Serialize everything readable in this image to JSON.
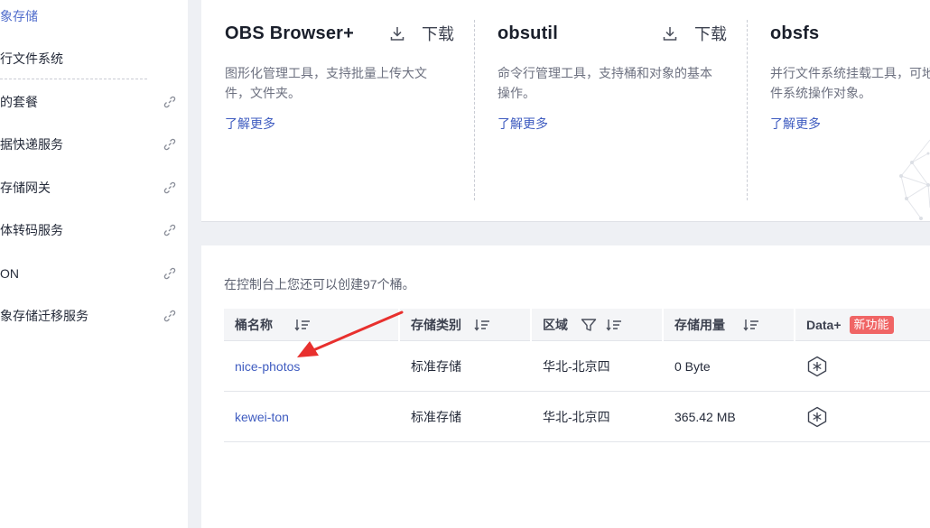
{
  "sidebar": {
    "items": [
      {
        "label": "象存储",
        "active": true,
        "external": false
      },
      {
        "label": "行文件系统",
        "active": false,
        "external": false
      },
      {
        "label": "的套餐",
        "active": false,
        "external": true
      },
      {
        "label": "据快递服务",
        "active": false,
        "external": true
      },
      {
        "label": "存储网关",
        "active": false,
        "external": true
      },
      {
        "label": "体转码服务",
        "active": false,
        "external": true
      },
      {
        "label": "ON",
        "active": false,
        "external": true
      },
      {
        "label": "象存储迁移服务",
        "active": false,
        "external": true
      }
    ]
  },
  "tools": [
    {
      "name": "OBS Browser+",
      "download_label": "下载",
      "description": "图形化管理工具，支持批量上传大文件，文件夹。",
      "more_label": "了解更多"
    },
    {
      "name": "obsutil",
      "download_label": "下载",
      "description": "命令行管理工具，支持桶和对象的基本操作。",
      "more_label": "了解更多"
    },
    {
      "name": "obsfs",
      "download_label": "",
      "description": "并行文件系统挂载工具，可地文件系统操作对象。",
      "more_label": "了解更多"
    }
  ],
  "buckets": {
    "hint": "在控制台上您还可以创建97个桶。",
    "columns": [
      {
        "label": "桶名称",
        "sortable": true,
        "filterable": false
      },
      {
        "label": "存储类别",
        "sortable": true,
        "filterable": false
      },
      {
        "label": "区域",
        "sortable": true,
        "filterable": true
      },
      {
        "label": "存储用量",
        "sortable": true,
        "filterable": false
      },
      {
        "label": "Data+",
        "sortable": false,
        "filterable": false,
        "badge": "新功能"
      }
    ],
    "rows": [
      {
        "name": "nice-photos",
        "storage_class": "标准存储",
        "region": "华北-北京四",
        "usage": "0 Byte"
      },
      {
        "name": "kewei-ton",
        "storage_class": "标准存储",
        "region": "华北-北京四",
        "usage": "365.42 MB"
      }
    ]
  },
  "colors": {
    "accent": "#526ecc",
    "link": "#3f5cc0",
    "badge": "#f06565",
    "annotation_arrow": "#e8302e"
  },
  "icons": {
    "sidebar_external": "link-icon",
    "tool_download": "download-icon",
    "column_sort": "sort-icon",
    "column_filter": "filter-icon",
    "data_plus": "hexagon-snowflake-icon"
  }
}
